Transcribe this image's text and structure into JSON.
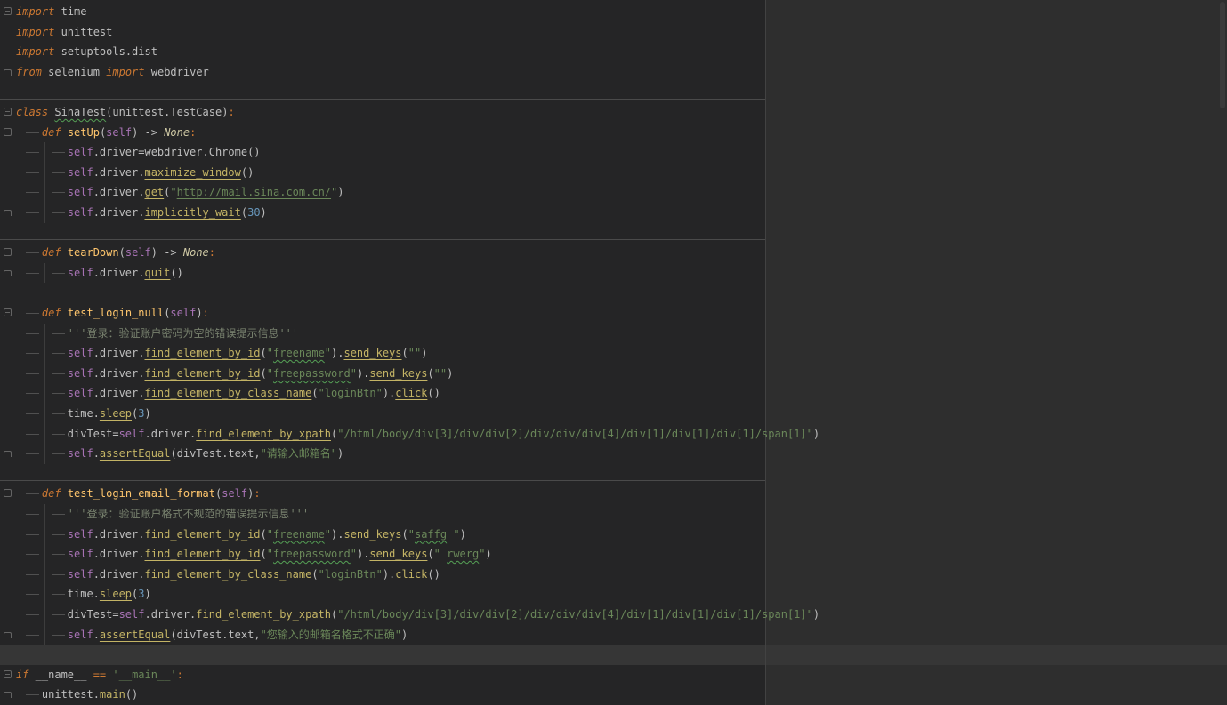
{
  "editor": {
    "colors": {
      "bg_code": "#252526",
      "bg_beyond_margin": "#2e2e2e",
      "caret_line": "#363636",
      "margin_line": "#424242",
      "method_separator": "#4a4a4a",
      "indent_guide": "#3d3d3d",
      "whitespace_mark": "#505050",
      "gutter_icon": "#646464",
      "keyword": "#cc7832",
      "default_text": "#bfbfbf",
      "function_decl": "#ffc66d",
      "function_call": "#c4b465",
      "self_param": "#a873b5",
      "string": "#6a8759",
      "number": "#6897bb",
      "docstring": "#77806d",
      "constant": "#cdc7a3",
      "operator": "#cc7832",
      "squiggle": "#55a055"
    },
    "lines": [
      {
        "indent": 0,
        "fold": "start",
        "tokens": [
          {
            "t": "import",
            "c": "kw"
          },
          {
            "t": " time",
            "c": "d"
          }
        ]
      },
      {
        "indent": 0,
        "tokens": [
          {
            "t": "import",
            "c": "kw"
          },
          {
            "t": " unittest",
            "c": "d"
          }
        ]
      },
      {
        "indent": 0,
        "tokens": [
          {
            "t": "import",
            "c": "kw"
          },
          {
            "t": " setuptools.dist",
            "c": "d"
          }
        ]
      },
      {
        "indent": 0,
        "fold": "end",
        "tokens": [
          {
            "t": "from",
            "c": "kw"
          },
          {
            "t": " selenium ",
            "c": "d"
          },
          {
            "t": "import",
            "c": "kw"
          },
          {
            "t": " webdriver",
            "c": "d"
          }
        ]
      },
      {
        "indent": 0,
        "tokens": []
      },
      {
        "indent": 0,
        "fold": "start",
        "separator": true,
        "tokens": [
          {
            "t": "class",
            "c": "kw"
          },
          {
            "t": " ",
            "c": "d"
          },
          {
            "t": "SinaTest",
            "c": "cls"
          },
          {
            "t": "(unittest.TestCase)",
            "c": "d"
          },
          {
            "t": ":",
            "c": "op"
          }
        ]
      },
      {
        "indent": 1,
        "fold": "start",
        "tokens": [
          {
            "t": "def",
            "c": "kw"
          },
          {
            "t": " ",
            "c": "d"
          },
          {
            "t": "setUp",
            "c": "fn"
          },
          {
            "t": "(",
            "c": "d"
          },
          {
            "t": "self",
            "c": "self"
          },
          {
            "t": ") -> ",
            "c": "d"
          },
          {
            "t": "None",
            "c": "const"
          },
          {
            "t": ":",
            "c": "op"
          }
        ]
      },
      {
        "indent": 2,
        "tokens": [
          {
            "t": "self",
            "c": "self"
          },
          {
            "t": ".driver=webdriver.Chrome()",
            "c": "d"
          }
        ]
      },
      {
        "indent": 2,
        "tokens": [
          {
            "t": "self",
            "c": "self"
          },
          {
            "t": ".driver.",
            "c": "d"
          },
          {
            "t": "maximize_window",
            "c": "call"
          },
          {
            "t": "()",
            "c": "d"
          }
        ]
      },
      {
        "indent": 2,
        "tokens": [
          {
            "t": "self",
            "c": "self"
          },
          {
            "t": ".driver.",
            "c": "d"
          },
          {
            "t": "get",
            "c": "call"
          },
          {
            "t": "(",
            "c": "d"
          },
          {
            "t": "\"",
            "c": "str"
          },
          {
            "t": "http://mail.sina.com.cn/",
            "c": "url"
          },
          {
            "t": "\"",
            "c": "str"
          },
          {
            "t": ")",
            "c": "d"
          }
        ]
      },
      {
        "indent": 2,
        "fold": "end",
        "tokens": [
          {
            "t": "self",
            "c": "self"
          },
          {
            "t": ".driver.",
            "c": "d"
          },
          {
            "t": "implicitly_wait",
            "c": "call"
          },
          {
            "t": "(",
            "c": "d"
          },
          {
            "t": "30",
            "c": "num"
          },
          {
            "t": ")",
            "c": "d"
          }
        ]
      },
      {
        "indent": 0,
        "tokens": []
      },
      {
        "indent": 1,
        "fold": "start",
        "separator": true,
        "tokens": [
          {
            "t": "def",
            "c": "kw"
          },
          {
            "t": " ",
            "c": "d"
          },
          {
            "t": "tearDown",
            "c": "fn"
          },
          {
            "t": "(",
            "c": "d"
          },
          {
            "t": "self",
            "c": "self"
          },
          {
            "t": ") -> ",
            "c": "d"
          },
          {
            "t": "None",
            "c": "const"
          },
          {
            "t": ":",
            "c": "op"
          }
        ]
      },
      {
        "indent": 2,
        "fold": "end",
        "tokens": [
          {
            "t": "self",
            "c": "self"
          },
          {
            "t": ".driver.",
            "c": "d"
          },
          {
            "t": "quit",
            "c": "call"
          },
          {
            "t": "()",
            "c": "d"
          }
        ]
      },
      {
        "indent": 0,
        "tokens": []
      },
      {
        "indent": 1,
        "fold": "start",
        "separator": true,
        "tokens": [
          {
            "t": "def",
            "c": "kw"
          },
          {
            "t": " ",
            "c": "d"
          },
          {
            "t": "test_login_null",
            "c": "fn"
          },
          {
            "t": "(",
            "c": "d"
          },
          {
            "t": "self",
            "c": "self"
          },
          {
            "t": ")",
            "c": "d"
          },
          {
            "t": ":",
            "c": "op"
          }
        ]
      },
      {
        "indent": 2,
        "tokens": [
          {
            "t": "'''登录：验证账户密码为空的错误提示信息'''",
            "c": "doc"
          }
        ]
      },
      {
        "indent": 2,
        "tokens": [
          {
            "t": "self",
            "c": "self"
          },
          {
            "t": ".driver.",
            "c": "d"
          },
          {
            "t": "find_element_by_id",
            "c": "call"
          },
          {
            "t": "(",
            "c": "d"
          },
          {
            "t": "\"",
            "c": "str"
          },
          {
            "t": "freename",
            "c": "typo"
          },
          {
            "t": "\"",
            "c": "str"
          },
          {
            "t": ").",
            "c": "d"
          },
          {
            "t": "send_keys",
            "c": "call"
          },
          {
            "t": "(",
            "c": "d"
          },
          {
            "t": "\"\"",
            "c": "str"
          },
          {
            "t": ")",
            "c": "d"
          }
        ]
      },
      {
        "indent": 2,
        "tokens": [
          {
            "t": "self",
            "c": "self"
          },
          {
            "t": ".driver.",
            "c": "d"
          },
          {
            "t": "find_element_by_id",
            "c": "call"
          },
          {
            "t": "(",
            "c": "d"
          },
          {
            "t": "\"",
            "c": "str"
          },
          {
            "t": "freepassword",
            "c": "typo"
          },
          {
            "t": "\"",
            "c": "str"
          },
          {
            "t": ").",
            "c": "d"
          },
          {
            "t": "send_keys",
            "c": "call"
          },
          {
            "t": "(",
            "c": "d"
          },
          {
            "t": "\"\"",
            "c": "str"
          },
          {
            "t": ")",
            "c": "d"
          }
        ]
      },
      {
        "indent": 2,
        "tokens": [
          {
            "t": "self",
            "c": "self"
          },
          {
            "t": ".driver.",
            "c": "d"
          },
          {
            "t": "find_element_by_class_name",
            "c": "call"
          },
          {
            "t": "(",
            "c": "d"
          },
          {
            "t": "\"loginBtn\"",
            "c": "str"
          },
          {
            "t": ").",
            "c": "d"
          },
          {
            "t": "click",
            "c": "call"
          },
          {
            "t": "()",
            "c": "d"
          }
        ]
      },
      {
        "indent": 2,
        "tokens": [
          {
            "t": "time.",
            "c": "d"
          },
          {
            "t": "sleep",
            "c": "call"
          },
          {
            "t": "(",
            "c": "d"
          },
          {
            "t": "3",
            "c": "num"
          },
          {
            "t": ")",
            "c": "d"
          }
        ]
      },
      {
        "indent": 2,
        "tokens": [
          {
            "t": "divTest=",
            "c": "d"
          },
          {
            "t": "self",
            "c": "self"
          },
          {
            "t": ".driver.",
            "c": "d"
          },
          {
            "t": "find_element_by_xpath",
            "c": "call"
          },
          {
            "t": "(",
            "c": "d"
          },
          {
            "t": "\"/html/body/div[3]/div/div[2]/div/div/div[4]/div[1]/div[1]/div[1]/span[1]\"",
            "c": "str"
          },
          {
            "t": ")",
            "c": "d"
          }
        ]
      },
      {
        "indent": 2,
        "fold": "end",
        "tokens": [
          {
            "t": "self",
            "c": "self"
          },
          {
            "t": ".",
            "c": "d"
          },
          {
            "t": "assertEqual",
            "c": "call"
          },
          {
            "t": "(divTest.text,",
            "c": "d"
          },
          {
            "t": "\"请输入邮箱名\"",
            "c": "str"
          },
          {
            "t": ")",
            "c": "d"
          }
        ]
      },
      {
        "indent": 0,
        "tokens": []
      },
      {
        "indent": 1,
        "fold": "start",
        "separator": true,
        "tokens": [
          {
            "t": "def",
            "c": "kw"
          },
          {
            "t": " ",
            "c": "d"
          },
          {
            "t": "test_login_email_format",
            "c": "fn"
          },
          {
            "t": "(",
            "c": "d"
          },
          {
            "t": "self",
            "c": "self"
          },
          {
            "t": ")",
            "c": "d"
          },
          {
            "t": ":",
            "c": "op"
          }
        ]
      },
      {
        "indent": 2,
        "tokens": [
          {
            "t": "'''登录：验证账户格式不规范的错误提示信息'''",
            "c": "doc"
          }
        ]
      },
      {
        "indent": 2,
        "tokens": [
          {
            "t": "self",
            "c": "self"
          },
          {
            "t": ".driver.",
            "c": "d"
          },
          {
            "t": "find_element_by_id",
            "c": "call"
          },
          {
            "t": "(",
            "c": "d"
          },
          {
            "t": "\"",
            "c": "str"
          },
          {
            "t": "freename",
            "c": "typo"
          },
          {
            "t": "\"",
            "c": "str"
          },
          {
            "t": ").",
            "c": "d"
          },
          {
            "t": "send_keys",
            "c": "call"
          },
          {
            "t": "(",
            "c": "d"
          },
          {
            "t": "\"",
            "c": "str"
          },
          {
            "t": "saffg",
            "c": "typo"
          },
          {
            "t": " \"",
            "c": "str"
          },
          {
            "t": ")",
            "c": "d"
          }
        ]
      },
      {
        "indent": 2,
        "tokens": [
          {
            "t": "self",
            "c": "self"
          },
          {
            "t": ".driver.",
            "c": "d"
          },
          {
            "t": "find_element_by_id",
            "c": "call"
          },
          {
            "t": "(",
            "c": "d"
          },
          {
            "t": "\"",
            "c": "str"
          },
          {
            "t": "freepassword",
            "c": "typo"
          },
          {
            "t": "\"",
            "c": "str"
          },
          {
            "t": ").",
            "c": "d"
          },
          {
            "t": "send_keys",
            "c": "call"
          },
          {
            "t": "(",
            "c": "d"
          },
          {
            "t": "\" ",
            "c": "str"
          },
          {
            "t": "rwerg",
            "c": "typo"
          },
          {
            "t": "\"",
            "c": "str"
          },
          {
            "t": ")",
            "c": "d"
          }
        ]
      },
      {
        "indent": 2,
        "tokens": [
          {
            "t": "self",
            "c": "self"
          },
          {
            "t": ".driver.",
            "c": "d"
          },
          {
            "t": "find_element_by_class_name",
            "c": "call"
          },
          {
            "t": "(",
            "c": "d"
          },
          {
            "t": "\"loginBtn\"",
            "c": "str"
          },
          {
            "t": ").",
            "c": "d"
          },
          {
            "t": "click",
            "c": "call"
          },
          {
            "t": "()",
            "c": "d"
          }
        ]
      },
      {
        "indent": 2,
        "tokens": [
          {
            "t": "time.",
            "c": "d"
          },
          {
            "t": "sleep",
            "c": "call"
          },
          {
            "t": "(",
            "c": "d"
          },
          {
            "t": "3",
            "c": "num"
          },
          {
            "t": ")",
            "c": "d"
          }
        ]
      },
      {
        "indent": 2,
        "tokens": [
          {
            "t": "divTest=",
            "c": "d"
          },
          {
            "t": "self",
            "c": "self"
          },
          {
            "t": ".driver.",
            "c": "d"
          },
          {
            "t": "find_element_by_xpath",
            "c": "call"
          },
          {
            "t": "(",
            "c": "d"
          },
          {
            "t": "\"/html/body/div[3]/div/div[2]/div/div/div[4]/div[1]/div[1]/div[1]/span[1]\"",
            "c": "str"
          },
          {
            "t": ")",
            "c": "d"
          }
        ]
      },
      {
        "indent": 2,
        "fold": "end",
        "tokens": [
          {
            "t": "self",
            "c": "self"
          },
          {
            "t": ".",
            "c": "d"
          },
          {
            "t": "assertEqual",
            "c": "call"
          },
          {
            "t": "(divTest.text,",
            "c": "d"
          },
          {
            "t": "\"您输入的邮箱名格式不正确\"",
            "c": "str"
          },
          {
            "t": ")",
            "c": "d"
          }
        ]
      },
      {
        "indent": 0,
        "caret_line": true,
        "tokens": []
      },
      {
        "indent": 0,
        "fold": "start",
        "tokens": [
          {
            "t": "if",
            "c": "kw"
          },
          {
            "t": " __name__ ",
            "c": "d"
          },
          {
            "t": "==",
            "c": "op"
          },
          {
            "t": " ",
            "c": "d"
          },
          {
            "t": "'__main__'",
            "c": "str"
          },
          {
            "t": ":",
            "c": "op"
          }
        ]
      },
      {
        "indent": 1,
        "fold": "end",
        "tokens": [
          {
            "t": "unittest.",
            "c": "d"
          },
          {
            "t": "main",
            "c": "call"
          },
          {
            "t": "()",
            "c": "d"
          }
        ]
      }
    ]
  }
}
